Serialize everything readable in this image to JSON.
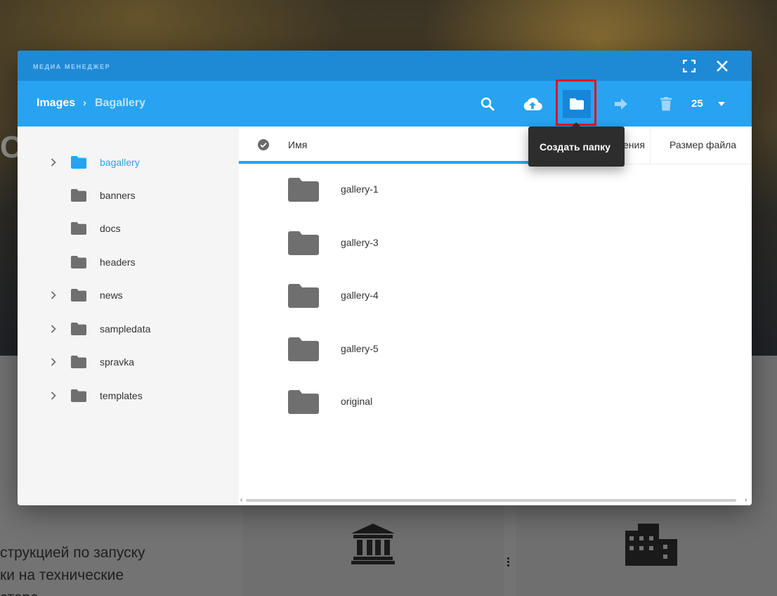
{
  "colors": {
    "modal_header": "#1e8ad6",
    "toolbar": "#27a3f1",
    "active_button": "#1786d6",
    "highlight": "#e0141e",
    "folder_gray": "#6f6f6f",
    "folder_selected": "#27a3f1",
    "tooltip_bg": "#2d2d2d"
  },
  "background": {
    "hero_letter": "С",
    "text_lines": [
      "струкцией по запуску",
      "ки на технические",
      "стора"
    ]
  },
  "modal": {
    "title": "МЕДИА МЕНЕДЖЕР",
    "fullscreen_icon": "fullscreen-icon",
    "close_icon": "close-icon"
  },
  "toolbar": {
    "breadcrumb_root": "Images",
    "breadcrumb_separator": "›",
    "breadcrumb_current": "Bagallery",
    "buttons": [
      {
        "icon": "search-icon"
      },
      {
        "icon": "upload-cloud-icon"
      },
      {
        "icon": "folder-icon",
        "active": true
      },
      {
        "icon": "move-arrow-icon"
      },
      {
        "icon": "trash-icon"
      }
    ],
    "page_size": "25"
  },
  "tooltip": {
    "text": "Создать папку"
  },
  "sidebar": {
    "items": [
      {
        "label": "bagallery",
        "expandable": true,
        "selected": true
      },
      {
        "label": "banners",
        "expandable": false
      },
      {
        "label": "docs",
        "expandable": false
      },
      {
        "label": "headers",
        "expandable": false
      },
      {
        "label": "news",
        "expandable": true
      },
      {
        "label": "sampledata",
        "expandable": true
      },
      {
        "label": "spravka",
        "expandable": true
      },
      {
        "label": "templates",
        "expandable": true
      }
    ]
  },
  "list": {
    "columns": {
      "name": "Имя",
      "date": "ения",
      "size": "Размер файла"
    },
    "rows": [
      {
        "name": "gallery-1"
      },
      {
        "name": "gallery-3"
      },
      {
        "name": "gallery-4"
      },
      {
        "name": "gallery-5"
      },
      {
        "name": "original"
      }
    ]
  }
}
